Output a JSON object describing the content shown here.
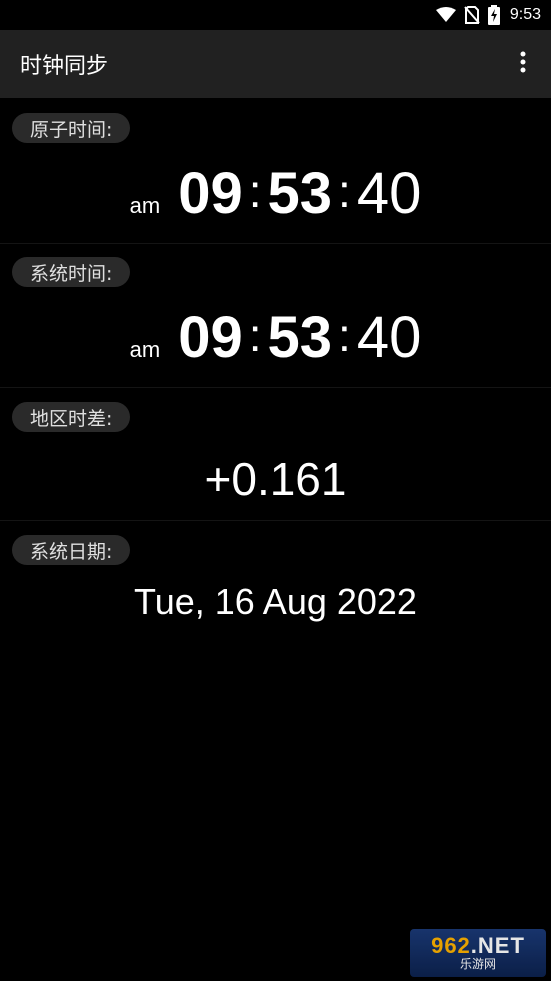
{
  "status_bar": {
    "time": "9:53",
    "icons": [
      "wifi-icon",
      "no-sim-icon",
      "battery-charging-icon"
    ]
  },
  "app_bar": {
    "title": "时钟同步",
    "menu_icon": "overflow-menu-icon"
  },
  "atomic_time": {
    "label": "原子时间:",
    "ampm": "am",
    "hours": "09",
    "minutes": "53",
    "seconds": "40",
    "separator": ":"
  },
  "system_time": {
    "label": "系统时间:",
    "ampm": "am",
    "hours": "09",
    "minutes": "53",
    "seconds": "40",
    "separator": ":"
  },
  "offset": {
    "label": "地区时差:",
    "value": "+0.161"
  },
  "system_date": {
    "label": "系统日期:",
    "value": "Tue, 16 Aug 2022"
  },
  "watermark": {
    "top_digits": "962",
    "top_suffix": ".NET",
    "bottom": "乐游网"
  }
}
